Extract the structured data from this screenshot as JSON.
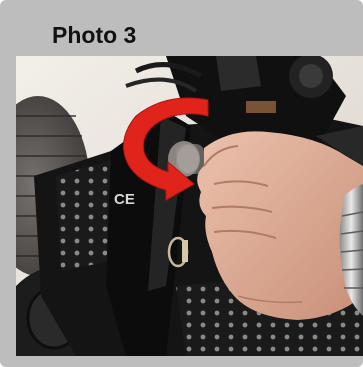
{
  "caption": {
    "title": "Photo 3"
  },
  "photo": {
    "description_icon": "photo-icon",
    "badge_text": "CE"
  },
  "colors": {
    "frame": "#bdbdbd",
    "arrow": "#e0231b",
    "machine": "#151515",
    "skin": "#d9a58d",
    "tire": "#5a5654"
  }
}
